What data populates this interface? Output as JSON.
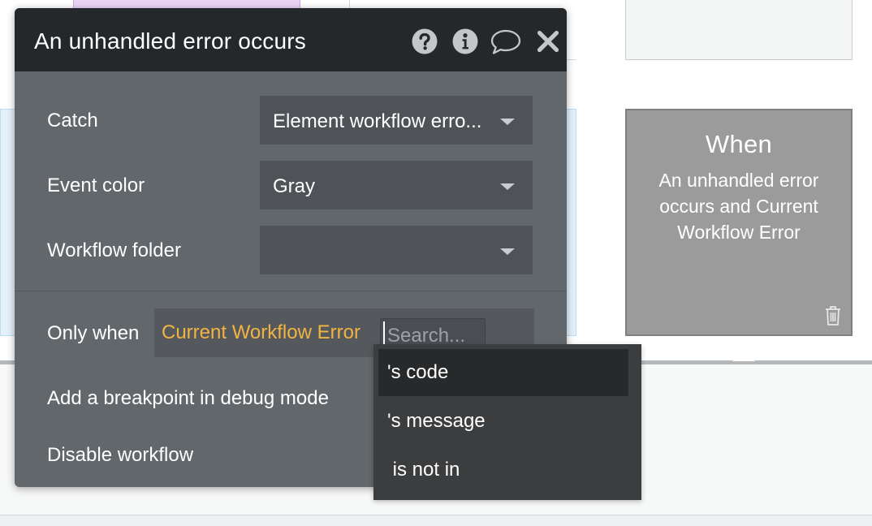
{
  "panel": {
    "title": "An unhandled error occurs",
    "header_icons": [
      "question-icon",
      "info-icon",
      "comment-icon",
      "close-icon"
    ],
    "fields": {
      "catch": {
        "label": "Catch",
        "value": "Element workflow erro..."
      },
      "event_color": {
        "label": "Event color",
        "value": "Gray"
      },
      "workflow_folder": {
        "label": "Workflow folder",
        "value": ""
      }
    },
    "only_when": {
      "label": "Only when",
      "expression": "Current Workflow Error",
      "search_placeholder": "Search..."
    },
    "breakpoint_label": "Add a breakpoint in debug mode",
    "disable_label": "Disable workflow"
  },
  "suggestions": {
    "items": [
      "'s code",
      "'s message",
      " is not in"
    ],
    "active_index": 0
  },
  "event_card": {
    "title": "When",
    "description": "An unhandled error occurs and Current Workflow Error",
    "icon": "trash-icon"
  },
  "colors": {
    "panel_bg": "#62676b",
    "header_bg": "#24282b",
    "dropdown_bg": "#4f5358",
    "expression_token": "#f2b441",
    "suggest_bg": "#3c3d3e",
    "suggest_active": "#27292b",
    "card_bg": "#9b9b9b"
  }
}
